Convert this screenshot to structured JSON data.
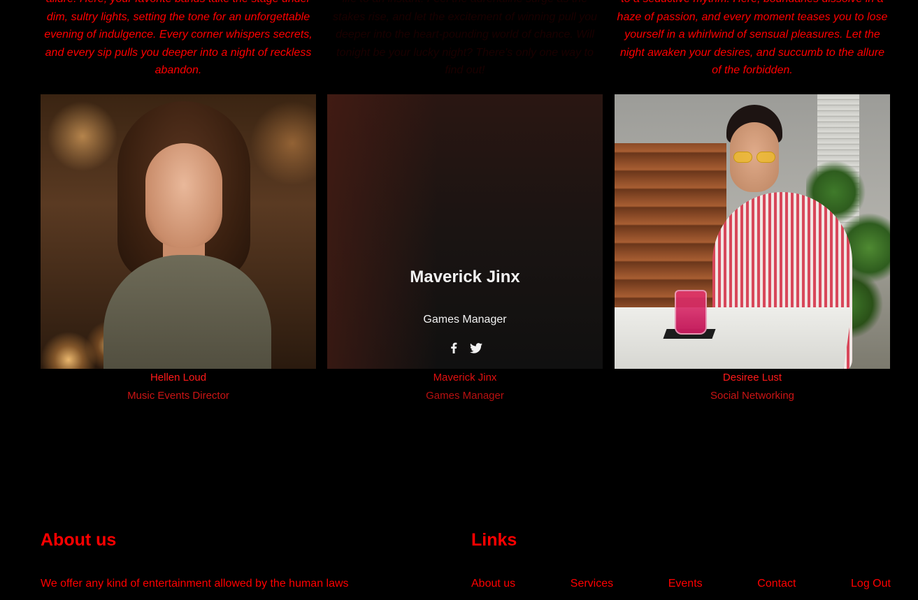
{
  "intro": {
    "col1": "allure. Here, your favorite bands take the stage under dim, sultry lights, setting the tone for an unforgettable evening of indulgence. Every corner whispers secrets, and every sip pulls you deeper into a night of reckless abandon.",
    "col2": "life to an instant. Feel the adrenaline surge as the stakes rise, and let the excitement of winning pull you deeper into the heart-pounding world of chance. Will tonight be your lucky night? There's only one way to find out!",
    "col3": "to a seductive mythm. Here, boundaries dissolve in a haze of passion, and every moment teases you to lose yourself in a whirlwind of sensual pleasures. Let the night awaken your desires, and succumb to the allure of the forbidden."
  },
  "team": [
    {
      "name": "Hellen Loud",
      "role": "Music Events Director"
    },
    {
      "name": "Maverick Jinx",
      "role": "Games Manager"
    },
    {
      "name": "Desiree Lust",
      "role": "Social Networking"
    }
  ],
  "hover_card": {
    "name": "Maverick Jinx",
    "role": "Games Manager",
    "social_icons": [
      "facebook-icon",
      "twitter-icon"
    ]
  },
  "footer": {
    "about_heading": "About us",
    "about_text": "We offer any kind of entertainment allowed by the human laws",
    "links_heading": "Links",
    "links": [
      "About us",
      "Services",
      "Events",
      "Contact",
      "Log Out"
    ]
  },
  "colors": {
    "accent": "#ff0000",
    "background": "#000000",
    "hover_text": "#f2f2f2"
  }
}
